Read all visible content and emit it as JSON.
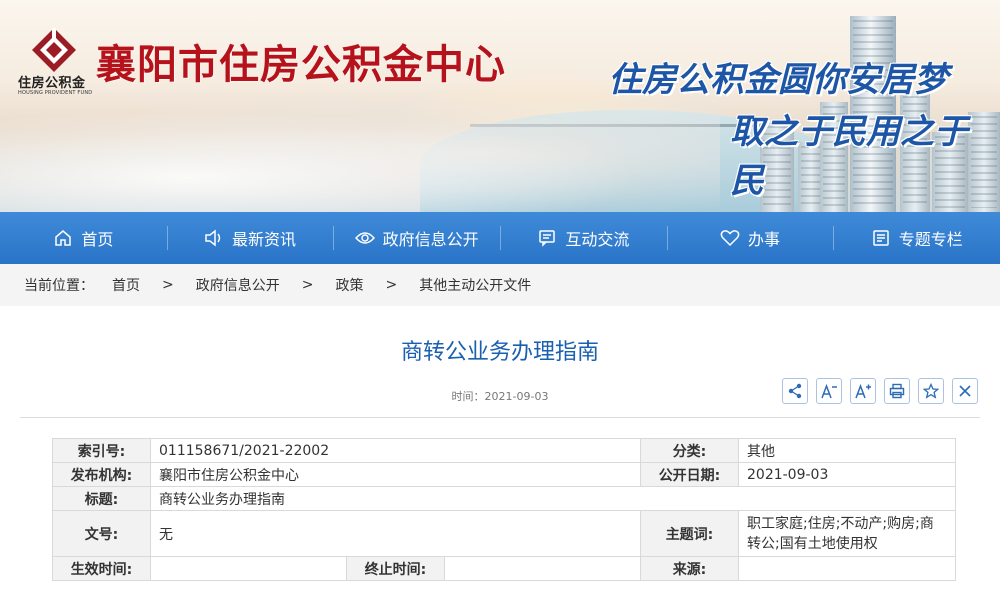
{
  "header": {
    "logo_text": "住房公积金",
    "logo_sub": "HOUSING PROVIDENT FUND",
    "site_title": "襄阳市住房公积金中心",
    "slogan_line1": "住房公积金圆你安居梦",
    "slogan_line2": "取之于民用之于民",
    "brand_color": "#b5121b",
    "slogan_color": "#1d56a6"
  },
  "nav": {
    "bg_color": "#2f7bd0",
    "items": [
      {
        "label": "首页",
        "icon": "home-icon"
      },
      {
        "label": "最新资讯",
        "icon": "speaker-icon"
      },
      {
        "label": "政府信息公开",
        "icon": "eye-icon"
      },
      {
        "label": "互动交流",
        "icon": "chat-icon"
      },
      {
        "label": "办事",
        "icon": "heart-icon"
      },
      {
        "label": "专题专栏",
        "icon": "column-icon"
      }
    ]
  },
  "breadcrumb": {
    "lead": "当前位置：",
    "items": [
      "首页",
      "政府信息公开",
      "政策",
      "其他主动公开文件"
    ],
    "separator": ">"
  },
  "article": {
    "title": "商转公业务办理指南",
    "date": "时间：2021-09-03",
    "tools": [
      "share-icon",
      "font-decrease-icon",
      "font-increase-icon",
      "print-icon",
      "favorite-icon",
      "close-icon"
    ]
  },
  "info_table": {
    "index_label": "索引号:",
    "index_value": "011158671/2021-22002",
    "category_label": "分类:",
    "category_value": "其他",
    "publisher_label": "发布机构:",
    "publisher_value": "襄阳市住房公积金中心",
    "publish_date_label": "公开日期:",
    "publish_date_value": "2021-09-03",
    "title_label": "标题:",
    "title_value": "商转公业务办理指南",
    "docno_label": "文号:",
    "docno_value": "无",
    "keywords_label": "主题词:",
    "keywords_value": "职工家庭;住房;不动产;购房;商转公;国有土地使用权",
    "effective_label": "生效时间:",
    "effective_value": "",
    "expire_label": "终止时间:",
    "expire_value": "",
    "source_label": "来源:",
    "source_value": ""
  }
}
